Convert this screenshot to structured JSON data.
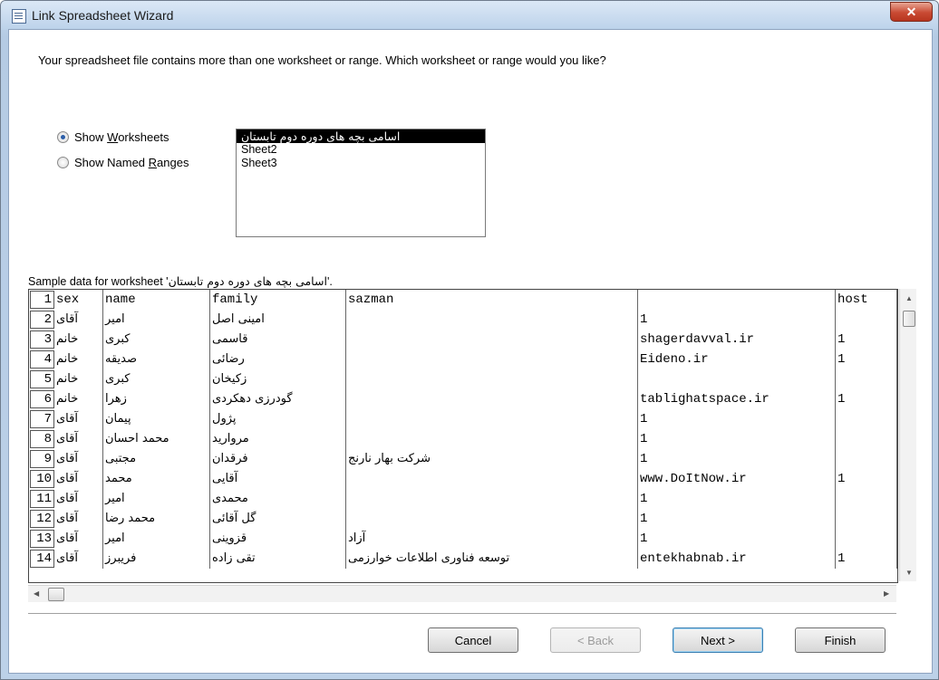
{
  "window": {
    "title": "Link Spreadsheet Wizard",
    "close_glyph": "✕"
  },
  "prompt": "Your spreadsheet file contains more than one worksheet or range. Which worksheet or range would you like?",
  "options": {
    "show_worksheets": {
      "label": "Show Worksheets",
      "access_key": "W",
      "checked": true
    },
    "show_named_ranges": {
      "label": "Show Named Ranges",
      "access_key": "R",
      "checked": false
    }
  },
  "sheets": [
    "اسامی بچه های دوره دوم تابستان",
    "Sheet2",
    "Sheet3"
  ],
  "sample": {
    "label_prefix": "Sample data for worksheet '",
    "sheet_name": "اسامی بچه های دوره دوم تابستان",
    "label_suffix": "'.",
    "rows": [
      [
        "1",
        "sex",
        "name",
        "family",
        "sazman",
        "",
        "host"
      ],
      [
        "2",
        "آقای",
        "امیر",
        "امینی اصل",
        "",
        "1",
        ""
      ],
      [
        "3",
        "خانم",
        "کبری",
        "قاسمی",
        "",
        "shagerdavval.ir",
        "1"
      ],
      [
        "4",
        "خانم",
        "صدیقه",
        "رضائی",
        "",
        "Eideno.ir",
        "1"
      ],
      [
        "5",
        "خانم",
        "کبری",
        "زکیخان",
        "",
        "",
        ""
      ],
      [
        "6",
        "خانم",
        "زهرا",
        "گودرزی دهکردی",
        "",
        "tablighatspace.ir",
        "1"
      ],
      [
        "7",
        "آقای",
        "پیمان",
        "پژول",
        "",
        "1",
        ""
      ],
      [
        "8",
        "آقای",
        "محمد احسان",
        "مروارید",
        "",
        "1",
        ""
      ],
      [
        "9",
        "آقای",
        "مجتبی",
        "فرقدان",
        "شرکت بهار نارنج",
        "1",
        ""
      ],
      [
        "10",
        "آقای",
        "محمد",
        "آقایی",
        "",
        "www.DoItNow.ir",
        "1"
      ],
      [
        "11",
        "آقای",
        "امیر",
        "محمدی",
        "",
        "1",
        ""
      ],
      [
        "12",
        "آقای",
        "محمد رضا",
        "گل آقائی",
        "",
        "1",
        ""
      ],
      [
        "13",
        "آقای",
        "امیر",
        "قزوینی",
        "آزاد",
        "1",
        ""
      ],
      [
        "14",
        "آقای",
        "فریبرز",
        "تقی زاده",
        "توسعه فناوری اطلاعات خوارزمی",
        "entekhabnab.ir",
        "1"
      ]
    ]
  },
  "buttons": {
    "cancel": "Cancel",
    "back": "< Back",
    "next": "Next >",
    "finish": "Finish"
  }
}
